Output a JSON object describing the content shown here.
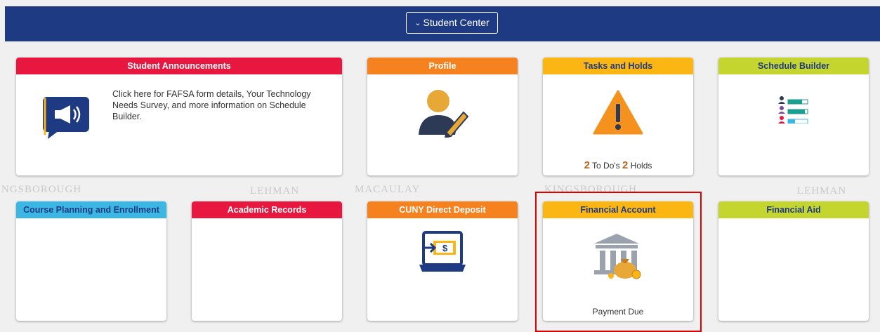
{
  "header": {
    "nav_label": "Student Center"
  },
  "watermarks": [
    "NGSBOROUGH",
    "LEHMAN",
    "MACAULAY",
    "KINGSBOROUGH",
    "LEHMAN"
  ],
  "tiles": {
    "announcements": {
      "title": "Student Announcements",
      "text": "Click here for FAFSA form details, Your Technology Needs Survey, and more information on Schedule Builder.",
      "color": "#e8173f"
    },
    "profile": {
      "title": "Profile",
      "color": "#f5821f"
    },
    "tasks": {
      "title": "Tasks and Holds",
      "todo_count": "2",
      "todo_label": "To Do's",
      "holds_count": "2",
      "holds_label": "Holds",
      "color": "#fbb614"
    },
    "schedule": {
      "title": "Schedule Builder",
      "color": "#c4d52f"
    },
    "course_planning": {
      "title": "Course Planning and Enrollment",
      "color": "#3cb7e3"
    },
    "academic_records": {
      "title": "Academic Records",
      "color": "#e8173f"
    },
    "direct_deposit": {
      "title": "CUNY Direct Deposit",
      "color": "#f5821f"
    },
    "financial_account": {
      "title": "Financial Account",
      "status": "Payment Due",
      "color": "#fbb614"
    },
    "financial_aid": {
      "title": "Financial Aid",
      "color": "#c4d52f"
    }
  },
  "icons": [
    "megaphone-icon",
    "profile-edit-icon",
    "warning-icon",
    "schedule-list-icon",
    "laptop-money-icon",
    "bank-moneybag-icon"
  ]
}
